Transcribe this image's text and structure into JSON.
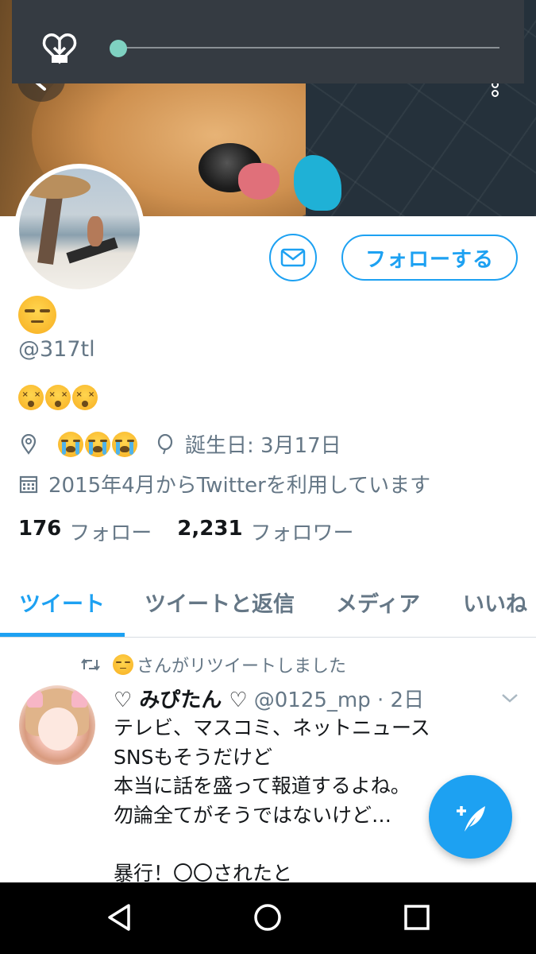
{
  "media_overlay": {
    "icon": "download-heart-icon",
    "progress": 0.02
  },
  "header": {
    "back_icon": "back-arrow-icon",
    "more_icon": "more-vertical-icon"
  },
  "profile": {
    "name_emoji": "unamused-face-emoji",
    "handle": "@317tl",
    "bio_emojis": [
      "dizzy-face-emoji",
      "dizzy-face-emoji",
      "dizzy-face-emoji"
    ],
    "location_emojis": [
      "crying-face-emoji",
      "crying-face-emoji",
      "crying-face-emoji"
    ],
    "birthday": "誕生日: 3月17日",
    "joined": "2015年4月からTwitterを利用しています",
    "following_count": "176",
    "following_label": "フォロー",
    "followers_count": "2,231",
    "followers_label": "フォロワー",
    "message_icon": "envelope-icon",
    "follow_button": "フォローする"
  },
  "tabs": [
    {
      "label": "ツイート",
      "active": true
    },
    {
      "label": "ツイートと返信",
      "active": false
    },
    {
      "label": "メディア",
      "active": false
    },
    {
      "label": "いいね",
      "active": false
    }
  ],
  "tweet": {
    "retweet_text": "さんがリツイートしました",
    "display_name": "♡ みぴたん ♡",
    "handle_time": "@0125_mp · 2日",
    "body": "テレビ、マスコミ、ネットニュース\nSNSもそうだけど\n本当に話を盛って報道するよね。\n勿論全てがそうではないけど…\n\n暴行！〇〇されたと"
  },
  "fab": {
    "icon": "compose-tweet-icon"
  },
  "navbar": {
    "back": "nav-back-icon",
    "home": "nav-home-icon",
    "recents": "nav-recents-icon"
  },
  "colors": {
    "accent": "#1da1f2",
    "secondary_text": "#657786",
    "overlay": "#353b42",
    "progress_thumb": "#7fd1c1"
  }
}
